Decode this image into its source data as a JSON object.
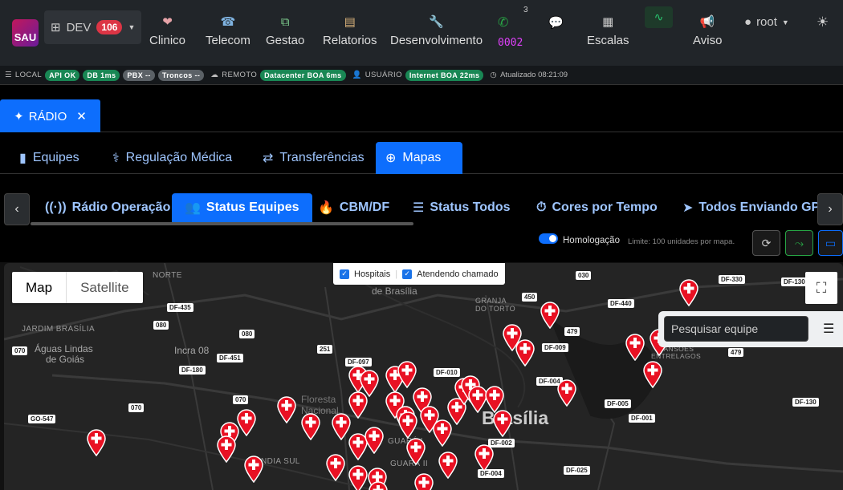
{
  "app": {
    "logo": "SAU",
    "env": "DEV",
    "env_badge": "106"
  },
  "nav": [
    {
      "label": "Clinico",
      "icon": "heart-icon"
    },
    {
      "label": "Telecom",
      "icon": "phone-icon"
    },
    {
      "label": "Gestao",
      "icon": "sitemap-icon"
    },
    {
      "label": "Relatorios",
      "icon": "book-icon"
    },
    {
      "label": "Desenvolvimento",
      "icon": "wrench-icon"
    }
  ],
  "phone": {
    "counter": "0002",
    "count_sup": "3"
  },
  "escalas": "Escalas",
  "aviso": "Aviso",
  "user": "root",
  "status": {
    "local": "LOCAL",
    "api": "API OK",
    "db": "DB 1ms",
    "pbx": "PBX --",
    "troncos": "Troncos --",
    "remoto": "REMOTO",
    "datacenter": "Datacenter BOA 6ms",
    "usuario": "USUÁRIO",
    "internet": "Internet BOA 22ms",
    "atualizado": "Atualizado 08:21:09"
  },
  "radio_tab": "RÁDIO",
  "tabs": [
    "Equipes",
    "Regulação Médica",
    "Transferências",
    "Mapas"
  ],
  "subtabs": [
    "Rádio Operação",
    "Status Equipes",
    "CBM/DF",
    "Status Todos",
    "Cores por Tempo",
    "Todos Enviando GPS"
  ],
  "homologacao": "Homologação",
  "limit_text": "Limite: 100 unidades por mapa.",
  "map": {
    "type_map": "Map",
    "type_sat": "Satellite",
    "layer_hosp": "Hospitais",
    "layer_atend": "Atendendo chamado",
    "search_placeholder": "Pesquisar equipe",
    "labels": [
      "NORTE",
      "JARDIM BRASÍLIA",
      "Águas Lindas",
      "de Goiás",
      "Incra 08",
      "Floresta",
      "Nacional",
      "GRANJA",
      "DO TORTO",
      "MANSÕES",
      "ENTRELAGOS",
      "GUARÁ I",
      "GUARÁ II",
      "NDIA SUL",
      "de Brasília"
    ],
    "city": "Brasília",
    "roads": [
      "DF-435",
      "080",
      "070",
      "DF-180",
      "080",
      "DF-451",
      "251",
      "DF-097",
      "070",
      "070",
      "GO-547",
      "450",
      "030",
      "DF-440",
      "479",
      "DF-009",
      "DF-330",
      "DF-130",
      "479",
      "DF-010",
      "DF-004",
      "DF-005",
      "DF-001",
      "DF-002",
      "DF-004",
      "DF-025",
      "DF-130"
    ]
  },
  "colors": {
    "accent": "#0d6efd",
    "ok": "#198754",
    "pin": "#e81123"
  }
}
